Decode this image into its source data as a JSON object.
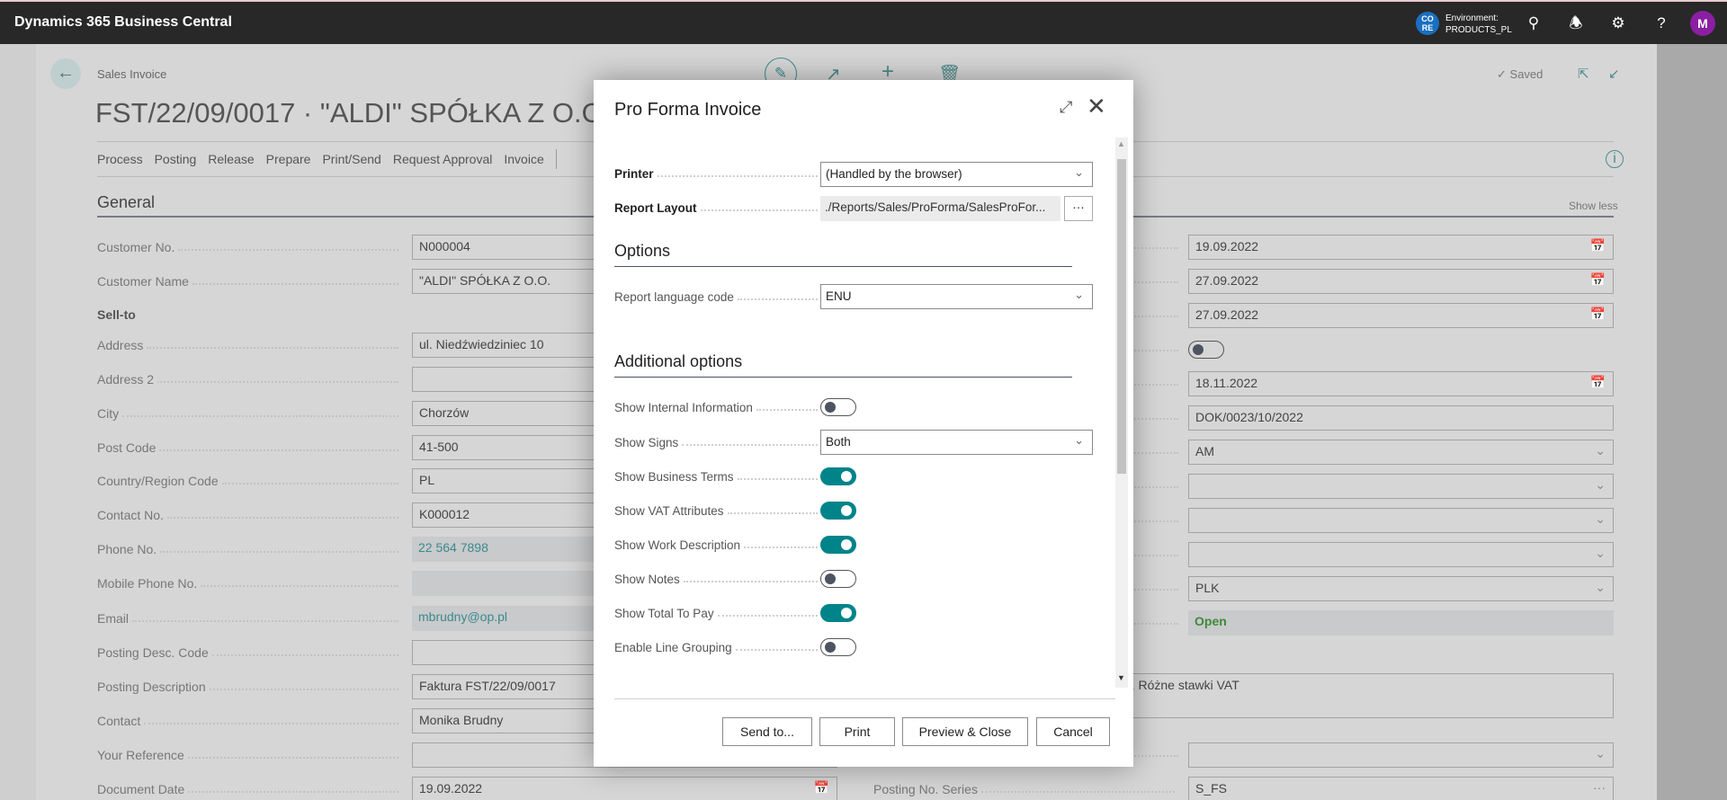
{
  "app": {
    "title": "Dynamics 365 Business Central",
    "env_badge": "CO RE",
    "env_label": "Environment:",
    "env_name": "PRODUCTS_PL",
    "avatar": "M"
  },
  "colors": {
    "accent": "#008489",
    "status_open": "#3f8a3a",
    "avatar": "#8a1fa3",
    "env_badge": "#1a6fbf"
  },
  "page": {
    "breadcrumb": "Sales Invoice",
    "title": "FST/22/09/0017 · \"ALDI\" SPÓŁKA Z O.O.",
    "saved": "Saved",
    "actions": [
      "Process",
      "Posting",
      "Release",
      "Prepare",
      "Print/Send",
      "Request Approval",
      "Invoice"
    ],
    "section": "General",
    "show_less": "Show less"
  },
  "left_fields": [
    {
      "label": "Customer No.",
      "value": "N000004",
      "kind": "input"
    },
    {
      "label": "Customer Name",
      "value": "\"ALDI\" SPÓŁKA Z O.O.",
      "kind": "input"
    },
    {
      "label": "Sell-to",
      "kind": "group"
    },
    {
      "label": "Address",
      "value": "ul. Niedźwiedziniec 10",
      "kind": "input"
    },
    {
      "label": "Address 2",
      "value": "",
      "kind": "input"
    },
    {
      "label": "City",
      "value": "Chorzów",
      "kind": "input"
    },
    {
      "label": "Post Code",
      "value": "41-500",
      "kind": "input"
    },
    {
      "label": "Country/Region Code",
      "value": "PL",
      "kind": "input"
    },
    {
      "label": "Contact No.",
      "value": "K000012",
      "kind": "input"
    },
    {
      "label": "Phone No.",
      "value": "22 564 7898",
      "kind": "link"
    },
    {
      "label": "Mobile Phone No.",
      "value": "",
      "kind": "readonly"
    },
    {
      "label": "Email",
      "value": "mbrudny@op.pl",
      "kind": "link"
    },
    {
      "label": "Posting Desc. Code",
      "value": "",
      "kind": "input"
    },
    {
      "label": "Posting Description",
      "value": "Faktura FST/22/09/0017",
      "kind": "input"
    },
    {
      "label": "Contact",
      "value": "Monika Brudny",
      "kind": "input"
    },
    {
      "label": "Your Reference",
      "value": "",
      "kind": "input"
    },
    {
      "label": "Document Date",
      "value": "19.09.2022",
      "kind": "date"
    }
  ],
  "right_fields": [
    {
      "value": "19.09.2022",
      "kind": "date"
    },
    {
      "value": "27.09.2022",
      "kind": "date"
    },
    {
      "value": "27.09.2022",
      "kind": "date"
    },
    {
      "value": false,
      "kind": "toggle"
    },
    {
      "value": "18.11.2022",
      "kind": "date"
    },
    {
      "value": "DOK/0023/10/2022",
      "kind": "input"
    },
    {
      "value": "AM",
      "kind": "select"
    },
    {
      "value": "",
      "kind": "select"
    },
    {
      "value": "",
      "kind": "select"
    },
    {
      "value": "",
      "kind": "select"
    },
    {
      "value": "PLK",
      "kind": "select"
    },
    {
      "value": "Open",
      "kind": "status"
    }
  ],
  "right_textarea": "tu, Różne stawki VAT",
  "right_bottom": [
    {
      "label": "",
      "value": "",
      "kind": "select"
    },
    {
      "label": "Posting No. Series",
      "value": "S_FS",
      "kind": "lookup"
    }
  ],
  "dialog": {
    "title": "Pro Forma Invoice",
    "printer_label": "Printer",
    "printer_value": "(Handled by the browser)",
    "layout_label": "Report Layout",
    "layout_value": "./Reports/Sales/ProForma/SalesProFor...",
    "layout_button": "···",
    "options_heading": "Options",
    "language_label": "Report language code",
    "language_value": "ENU",
    "additional_heading": "Additional options",
    "options": [
      {
        "label": "Show Internal Information",
        "kind": "toggle",
        "value": false
      },
      {
        "label": "Show Signs",
        "kind": "select",
        "value": "Both"
      },
      {
        "label": "Show Business Terms",
        "kind": "toggle",
        "value": true
      },
      {
        "label": "Show VAT Attributes",
        "kind": "toggle",
        "value": true
      },
      {
        "label": "Show Work Description",
        "kind": "toggle",
        "value": true
      },
      {
        "label": "Show Notes",
        "kind": "toggle",
        "value": false
      },
      {
        "label": "Show Total To Pay",
        "kind": "toggle",
        "value": true
      },
      {
        "label": "Enable Line Grouping",
        "kind": "toggle",
        "value": false
      }
    ],
    "buttons": [
      "Send to...",
      "Print",
      "Preview & Close",
      "Cancel"
    ]
  }
}
